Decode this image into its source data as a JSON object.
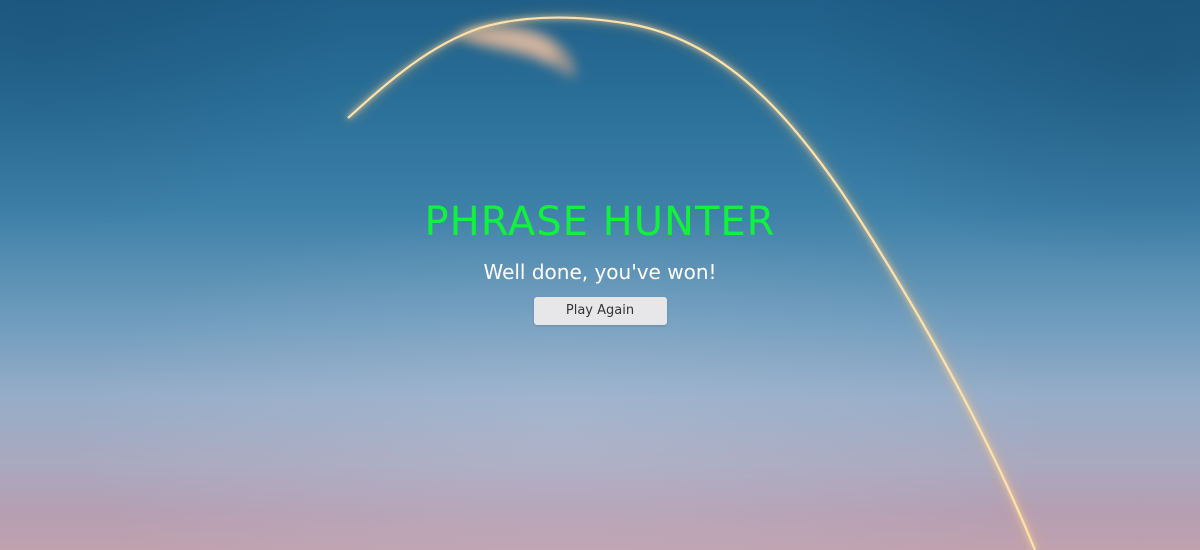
{
  "game": {
    "title": "PHRASE HUNTER",
    "result_message": "Well done, you've won!",
    "play_again_label": "Play Again"
  },
  "colors": {
    "title": "#11f23b",
    "message": "#ffffff",
    "button_bg": "#e7e7ea",
    "button_text": "#333333",
    "sky_top": "#1f5f88",
    "sky_bottom": "#c0a1ae",
    "rocket_trail": "#ffd79a"
  }
}
